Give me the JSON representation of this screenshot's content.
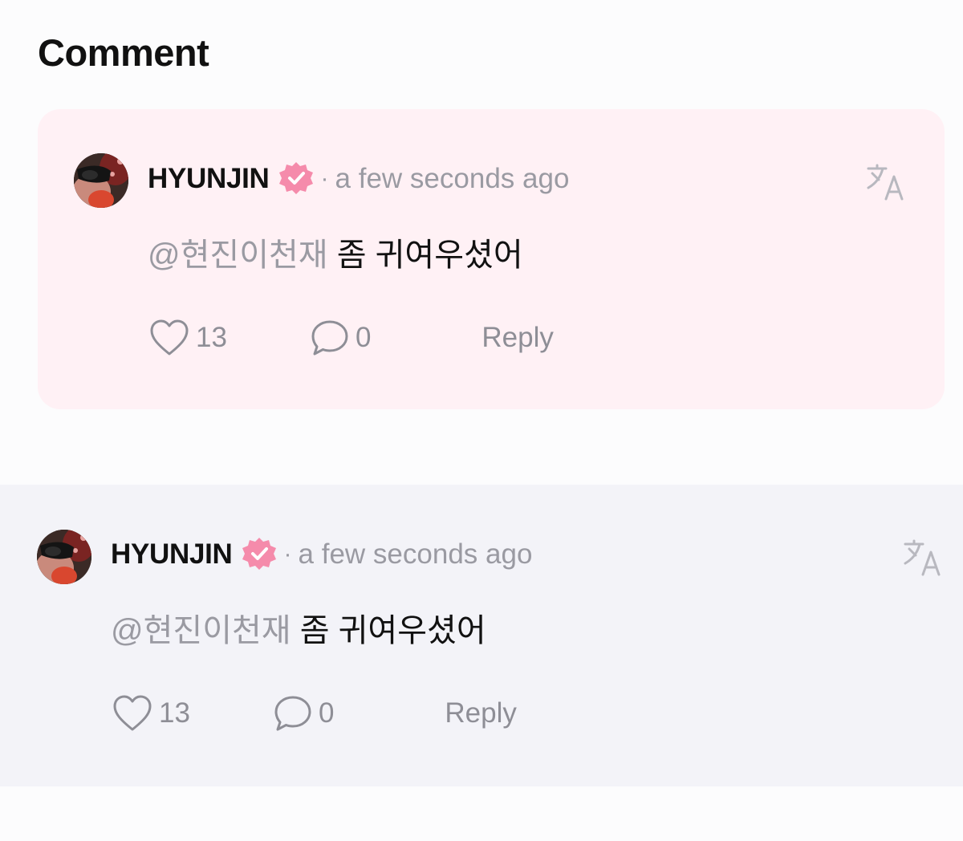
{
  "header": {
    "title": "Comment"
  },
  "comments": [
    {
      "author": "HYUNJIN",
      "verified_icon": "verified-badge-icon",
      "separator": "·",
      "time": "a few seconds ago",
      "mention": "@현진이천재",
      "text": " 좀 귀여우셨어",
      "likes": "13",
      "replies": "0",
      "reply_label": "Reply",
      "translate_icon": "translate-icon",
      "highlighted": true
    },
    {
      "author": "HYUNJIN",
      "verified_icon": "verified-badge-icon",
      "separator": "·",
      "time": "a few seconds ago",
      "mention": "@현진이천재",
      "text": " 좀 귀여우셨어",
      "likes": "13",
      "replies": "0",
      "reply_label": "Reply",
      "translate_icon": "translate-icon",
      "highlighted": false
    }
  ],
  "colors": {
    "background": "#fcfcfd",
    "highlight_card": "#fff1f5",
    "gray_band": "#f3f3f8",
    "badge_pink": "#f58bab",
    "muted_text": "#9a9aa2"
  }
}
